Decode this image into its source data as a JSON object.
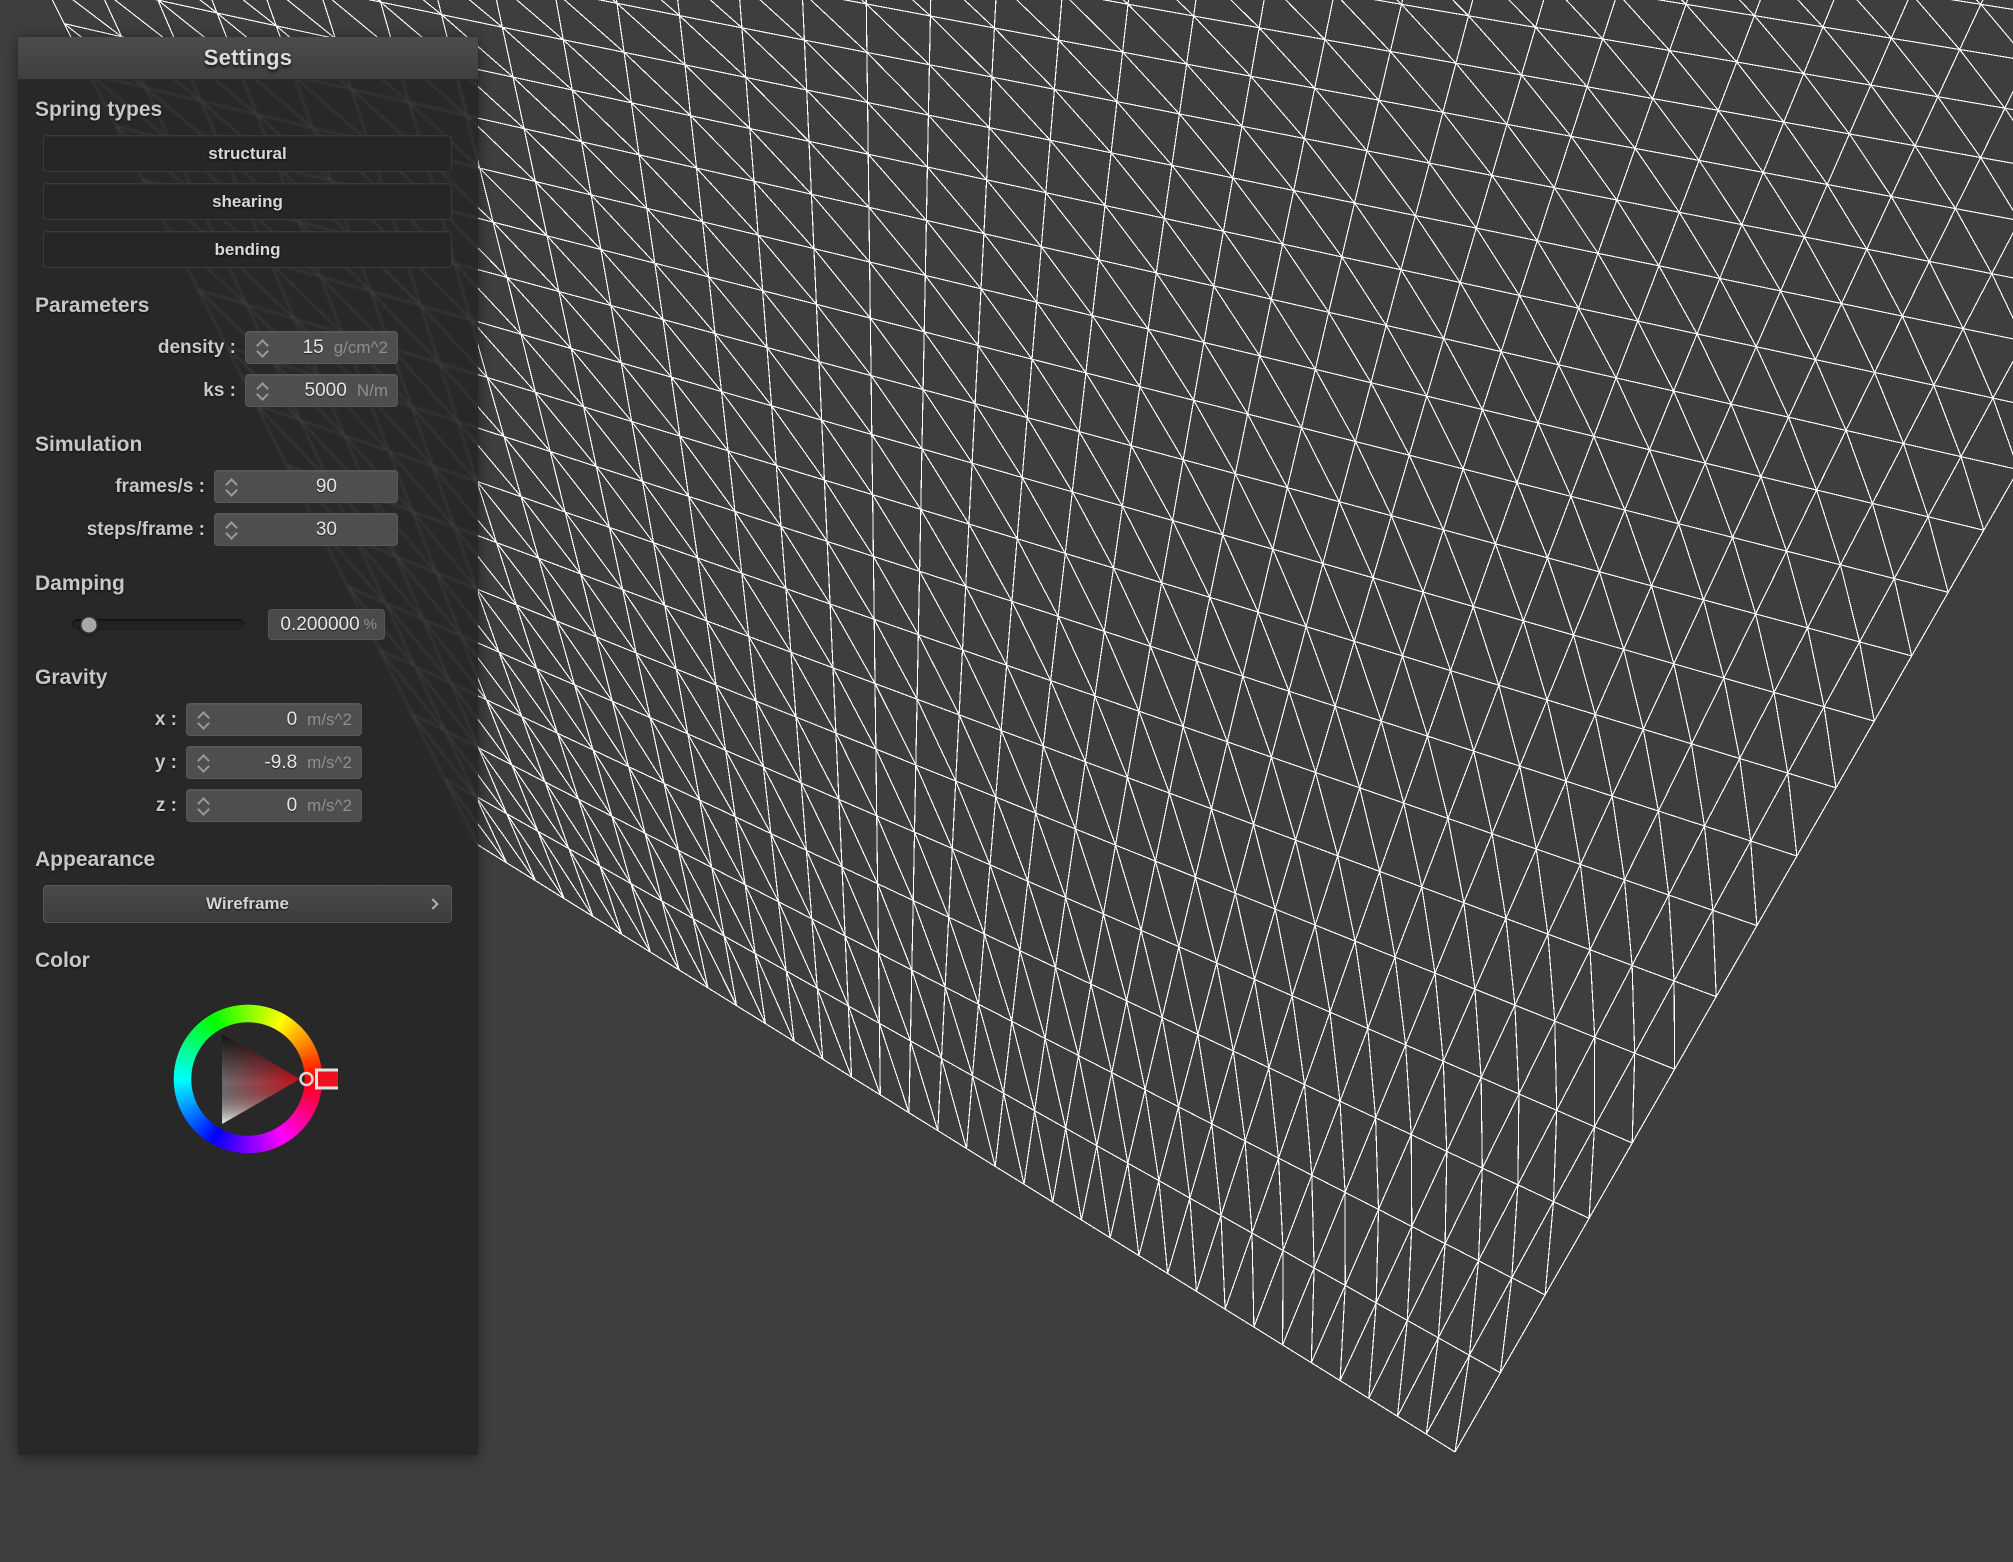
{
  "window": {
    "background_color": "#3e3e3e",
    "mesh_line_color": "#ffffff"
  },
  "panel": {
    "title": "Settings",
    "sections": {
      "spring_types": {
        "heading": "Spring types",
        "buttons": [
          {
            "label": "structural",
            "name": "spring-type-structural"
          },
          {
            "label": "shearing",
            "name": "spring-type-shearing"
          },
          {
            "label": "bending",
            "name": "spring-type-bending"
          }
        ]
      },
      "parameters": {
        "heading": "Parameters",
        "fields": [
          {
            "label": "density :",
            "value": "15",
            "unit": "g/cm^2"
          },
          {
            "label": "ks :",
            "value": "5000",
            "unit": "N/m"
          }
        ]
      },
      "simulation": {
        "heading": "Simulation",
        "fields": [
          {
            "label": "frames/s :",
            "value": "90",
            "unit": ""
          },
          {
            "label": "steps/frame :",
            "value": "30",
            "unit": ""
          }
        ]
      },
      "damping": {
        "heading": "Damping",
        "value": "0.200000",
        "unit": "%",
        "slider_percent": 10
      },
      "gravity": {
        "heading": "Gravity",
        "fields": [
          {
            "label": "x :",
            "value": "0",
            "unit": "m/s^2"
          },
          {
            "label": "y :",
            "value": "-9.8",
            "unit": "m/s^2"
          },
          {
            "label": "z :",
            "value": "0",
            "unit": "m/s^2"
          }
        ]
      },
      "appearance": {
        "heading": "Appearance",
        "selected": "Wireframe"
      },
      "color": {
        "heading": "Color",
        "selected_hex": "#ee1122",
        "selected_hue_degrees": 0
      }
    }
  }
}
